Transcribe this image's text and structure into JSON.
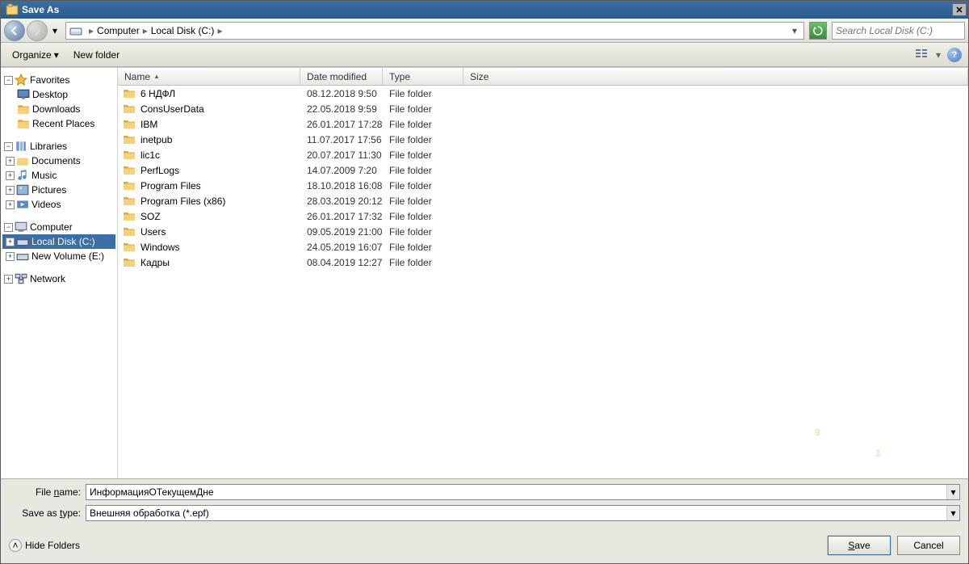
{
  "title": "Save As",
  "breadcrumb": {
    "root": "Computer",
    "path": "Local Disk (C:)"
  },
  "search_placeholder": "Search Local Disk (C:)",
  "toolbar": {
    "organize": "Organize",
    "new_folder": "New folder"
  },
  "sidebar": {
    "favorites": {
      "label": "Favorites",
      "items": [
        "Desktop",
        "Downloads",
        "Recent Places"
      ]
    },
    "libraries": {
      "label": "Libraries",
      "items": [
        "Documents",
        "Music",
        "Pictures",
        "Videos"
      ]
    },
    "computer": {
      "label": "Computer",
      "items": [
        "Local Disk (C:)",
        "New Volume (E:)"
      ]
    },
    "network": {
      "label": "Network"
    }
  },
  "columns": {
    "name": "Name",
    "date": "Date modified",
    "type": "Type",
    "size": "Size"
  },
  "files": [
    {
      "name": "6 НДФЛ",
      "date": "08.12.2018 9:50",
      "type": "File folder"
    },
    {
      "name": "ConsUserData",
      "date": "22.05.2018 9:59",
      "type": "File folder"
    },
    {
      "name": "IBM",
      "date": "26.01.2017 17:28",
      "type": "File folder"
    },
    {
      "name": "inetpub",
      "date": "11.07.2017 17:56",
      "type": "File folder"
    },
    {
      "name": "lic1c",
      "date": "20.07.2017 11:30",
      "type": "File folder"
    },
    {
      "name": "PerfLogs",
      "date": "14.07.2009 7:20",
      "type": "File folder"
    },
    {
      "name": "Program Files",
      "date": "18.10.2018 16:08",
      "type": "File folder"
    },
    {
      "name": "Program Files (x86)",
      "date": "28.03.2019 20:12",
      "type": "File folder"
    },
    {
      "name": "SOZ",
      "date": "26.01.2017 17:32",
      "type": "File folder"
    },
    {
      "name": "Users",
      "date": "09.05.2019 21:00",
      "type": "File folder"
    },
    {
      "name": "Windows",
      "date": "24.05.2019 16:07",
      "type": "File folder"
    },
    {
      "name": "Кадры",
      "date": "08.04.2019 12:27",
      "type": "File folder"
    }
  ],
  "filename_label": "File name:",
  "filename_value": "ИнформацияОТекущемДне",
  "type_label": "Save as type:",
  "type_value": "Внешняя обработка (*.epf)",
  "hide_folders": "Hide Folders",
  "save_btn": "Save",
  "cancel_btn": "Cancel"
}
